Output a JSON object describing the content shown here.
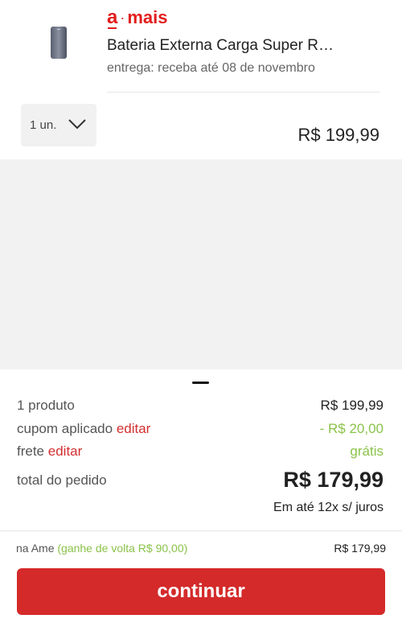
{
  "product": {
    "seller": {
      "letter": "a",
      "dot": "·",
      "suffix": "mais"
    },
    "name": "Bateria Externa Carga Super R…",
    "delivery": "entrega: receba até 08 de novembro",
    "quantity": "1 un.",
    "price": "R$ 199,99",
    "image_icon": "power-bank-image"
  },
  "summary": {
    "products_label": "1 produto",
    "products_value": "R$ 199,99",
    "coupon_label": "cupom aplicado",
    "coupon_edit": "editar",
    "coupon_value": "- R$ 20,00",
    "shipping_label": "frete",
    "shipping_edit": "editar",
    "shipping_value": "grátis",
    "total_label": "total do pedido",
    "total_value": "R$ 179,99",
    "installments": "Em até 12x s/ juros"
  },
  "ame": {
    "label": "na Ame",
    "cashback": "(ganhe de volta R$ 90,00)",
    "value": "R$ 179,99"
  },
  "continue_label": "continuar",
  "colors": {
    "accent": "#d42a2a",
    "cashback": "#8bc34a",
    "background_gray": "#f2f2f2"
  }
}
